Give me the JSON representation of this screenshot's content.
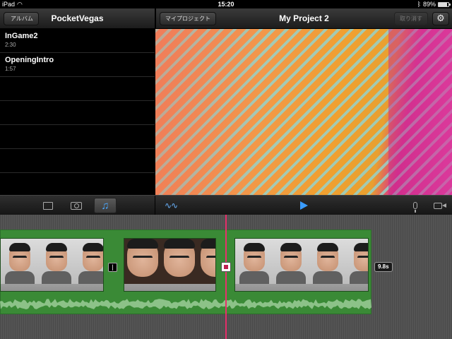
{
  "status_bar": {
    "device": "iPad",
    "time": "15:20",
    "battery": "89%",
    "battery_level": 0.89
  },
  "browser": {
    "back_label": "アルバム",
    "title": "PocketVegas",
    "songs": [
      {
        "name": "InGame2",
        "duration": "2:30"
      },
      {
        "name": "OpeningIntro",
        "duration": "1:57"
      }
    ]
  },
  "project": {
    "projects_label": "マイプロジェクト",
    "title": "My Project 2",
    "undo_label": "取り消す"
  },
  "toolbar": {
    "media_tabs": [
      "video-tab",
      "photo-tab",
      "audio-tab"
    ],
    "active_tab": "audio-tab"
  },
  "timeline": {
    "selected_clip_duration": "9.8s"
  },
  "colors": {
    "clip_green": "#3a8a36",
    "playhead": "#e8306c",
    "accent_blue": "#3a9cff"
  }
}
